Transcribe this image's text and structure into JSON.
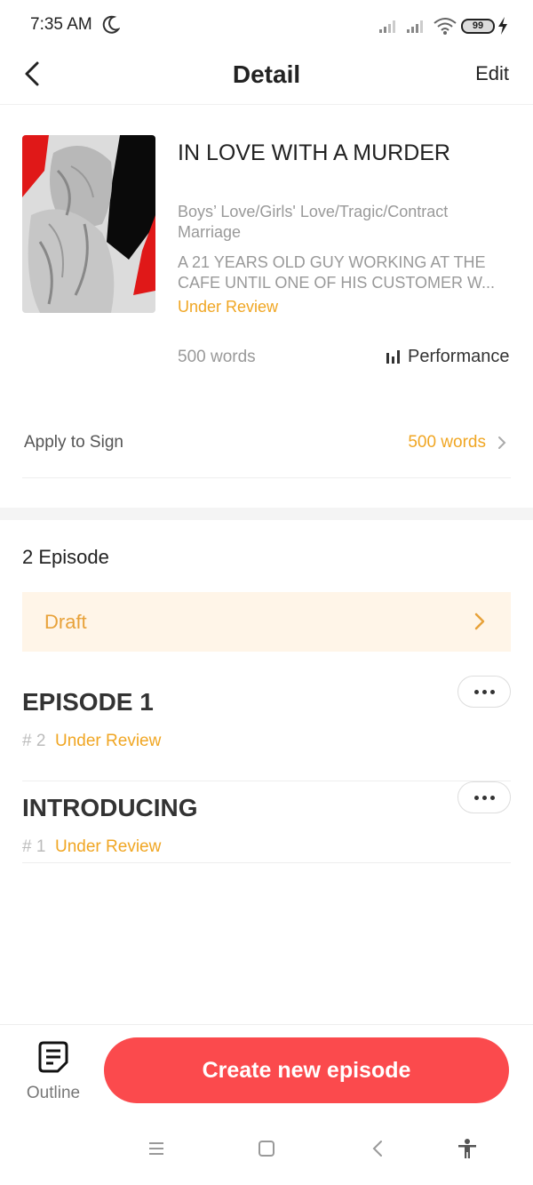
{
  "status_bar": {
    "time": "7:35 AM",
    "battery": "99"
  },
  "header": {
    "title": "Detail",
    "edit_label": "Edit"
  },
  "book": {
    "title": "IN LOVE WITH A MURDER",
    "genres": "Boys’ Love/Girls' Love/Tragic/Contract Marriage",
    "description": "A 21 YEARS OLD GUY WORKING AT THE CAFE UNTIL ONE OF HIS CUSTOMER W...",
    "status": "Under Review",
    "words": "500 words",
    "performance_label": "Performance"
  },
  "apply": {
    "label": "Apply to Sign",
    "value": "500 words"
  },
  "episodes": {
    "count_label": "2 Episode",
    "draft_label": "Draft",
    "items": [
      {
        "title": "EPISODE 1",
        "number": "# 2",
        "status": "Under Review"
      },
      {
        "title": "INTRODUCING",
        "number": "# 1",
        "status": "Under Review"
      }
    ]
  },
  "bottom_bar": {
    "outline_label": "Outline",
    "create_label": "Create new episode"
  },
  "colors": {
    "accent": "#f0a623",
    "primary": "#fb4a4d",
    "draft_bg": "#fff5e8"
  },
  "icons": [
    "moon-icon",
    "signal-icon",
    "wifi-icon",
    "battery-icon",
    "charging-icon",
    "back-icon",
    "bar-chart-icon",
    "chevron-right-icon",
    "more-icon",
    "outline-icon",
    "menu-icon",
    "home-icon",
    "nav-back-icon",
    "accessibility-icon"
  ]
}
